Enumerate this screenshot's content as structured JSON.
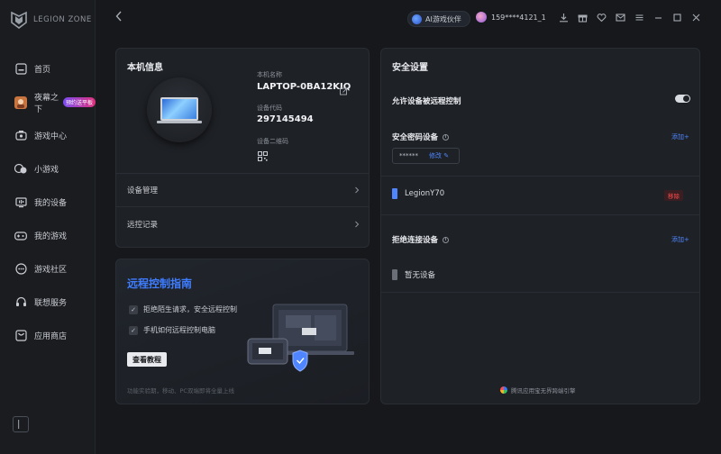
{
  "app": {
    "brand": "LEGION ZONE"
  },
  "sidebar": {
    "items": [
      {
        "label": "首页",
        "icon": "home-icon"
      },
      {
        "label": "夜幕之下",
        "icon": "game-avatar-icon",
        "badge": "预约送平板"
      },
      {
        "label": "游戏中心",
        "icon": "gamepad-icon"
      },
      {
        "label": "小游戏",
        "icon": "mini-game-icon"
      },
      {
        "label": "我的设备",
        "icon": "device-icon"
      },
      {
        "label": "我的游戏",
        "icon": "controller-icon"
      },
      {
        "label": "游戏社区",
        "icon": "community-icon"
      },
      {
        "label": "联想服务",
        "icon": "headset-icon"
      },
      {
        "label": "应用商店",
        "icon": "store-icon"
      }
    ]
  },
  "topbar": {
    "ai_label": "AI游戏伙伴",
    "username": "159****4121_1"
  },
  "info": {
    "title": "本机信息",
    "name_label": "本机名称",
    "name_value": "LAPTOP-0BA12KIQ",
    "code_label": "设备代码",
    "code_value": "297145494",
    "qr_label": "设备二维码",
    "device_mgmt": "设备管理",
    "remote_log": "远控记录"
  },
  "guide": {
    "title": "远程控制指南",
    "check1": "拒绝陌生请求，安全远程控制",
    "check2": "手机如何远程控制电脑",
    "button": "查看教程",
    "footnote": "功能实验期，移动、PC双端即将全量上线"
  },
  "security": {
    "title": "安全设置",
    "allow_remote": "允许设备被远程控制",
    "allow_remote_on": true,
    "trusted_title": "安全密码设备",
    "add1": "添加+",
    "password_mask": "******",
    "password_edit": "修改",
    "device_name": "LegionY70",
    "remove": "移除",
    "blocked_title": "拒绝连接设备",
    "add2": "添加+",
    "no_device": "暂无设备",
    "footer": "腾讯应用宝无界跨端引擎"
  },
  "colors": {
    "accent": "#3f7dff",
    "link": "#4f86ff",
    "danger": "#ff4d4d",
    "background": "#16181c",
    "card": "#1e2126"
  }
}
